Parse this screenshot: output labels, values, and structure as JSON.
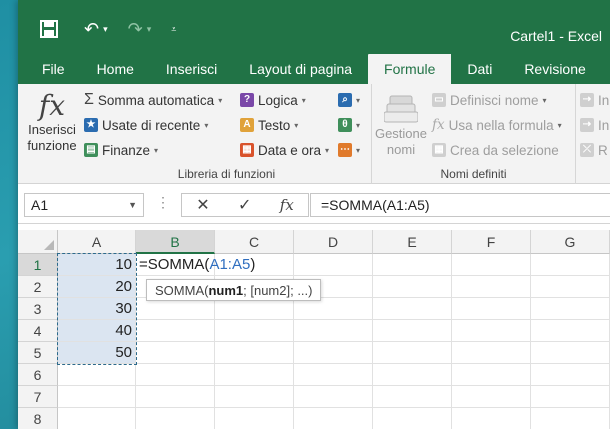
{
  "window": {
    "title": "Cartel1 - Excel"
  },
  "qat": {
    "save_icon": "save-icon",
    "undo_icon": "undo-icon",
    "redo_icon": "redo-icon",
    "customize_icon": "customize-icon"
  },
  "tabs": [
    {
      "label": "File",
      "active": false
    },
    {
      "label": "Home",
      "active": false
    },
    {
      "label": "Inserisci",
      "active": false
    },
    {
      "label": "Layout di pagina",
      "active": false
    },
    {
      "label": "Formule",
      "active": true
    },
    {
      "label": "Dati",
      "active": false
    },
    {
      "label": "Revisione",
      "active": false
    }
  ],
  "ribbon": {
    "insert_function": {
      "line1": "Inserisci",
      "line2": "funzione",
      "glyph": "fx"
    },
    "library": {
      "label": "Libreria di funzioni",
      "autosum": "Somma automatica",
      "autosum_glyph": "Σ",
      "recent": "Usate di recente",
      "finance": "Finanze",
      "logical": "Logica",
      "text": "Testo",
      "datetime": "Data e ora"
    },
    "names": {
      "label": "Nomi definiti",
      "manager_line1": "Gestione",
      "manager_line2": "nomi",
      "define": "Definisci nome",
      "use_in_formula": "Usa nella formula",
      "create_from_selection": "Crea da selezione"
    },
    "audit": {
      "btn1": "In",
      "btn2": "In",
      "btn3": "R"
    }
  },
  "formula_bar": {
    "name_box": "A1",
    "cancel_glyph": "✕",
    "enter_glyph": "✓",
    "fx_glyph": "fx",
    "formula": "=SOMMA(A1:A5)"
  },
  "grid": {
    "columns": [
      "A",
      "B",
      "C",
      "D",
      "E",
      "F",
      "G"
    ],
    "rows": [
      "1",
      "2",
      "3",
      "4",
      "5",
      "6",
      "7",
      "8"
    ],
    "a_values": [
      "10",
      "20",
      "30",
      "40",
      "50"
    ],
    "edit_cell": {
      "prefix": "=SOMMA(",
      "ref": "A1:A5",
      "suffix": ")"
    },
    "tooltip": {
      "fn": "SOMMA(",
      "arg1": "num1",
      "rest": "; [num2]; ...)"
    }
  },
  "colors": {
    "accent": "#217346",
    "selection": "#dbe5f1",
    "reference": "#2f6ebf"
  }
}
